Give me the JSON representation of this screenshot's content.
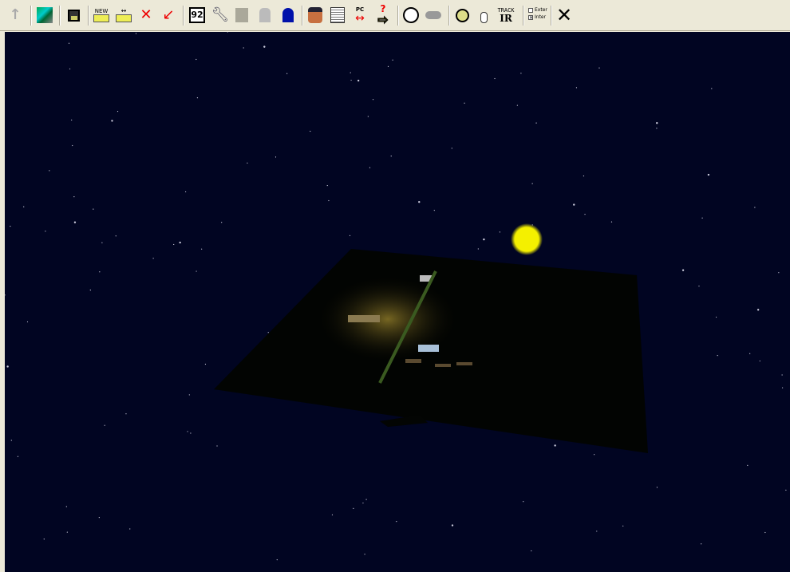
{
  "toolbar": {
    "new_label": "NEW",
    "track_label": "TRACK",
    "ir_label": "IR",
    "scenario_number": "92",
    "pc_label": "PC",
    "checkbox_exterior": {
      "label": "Exter",
      "checked": false
    },
    "checkbox_interior": {
      "label": "Inter",
      "checked": true
    },
    "icons": [
      "up-arrow-icon",
      "route-map-icon",
      "save-icon",
      "new-train-icon",
      "move-train-icon",
      "delete-train-icon",
      "pointer-icon",
      "scenario-icon",
      "wrench-icon",
      "disabled-chip-icon",
      "disabled-fuel-icon",
      "bell-icon",
      "driver-icon",
      "list-icon",
      "pc-driver-swap-icon",
      "help-arrow-icon",
      "clock-icon",
      "weather-icon",
      "steering-wheel-icon",
      "mouse-icon",
      "trackir-icon",
      "close-icon"
    ]
  },
  "colors": {
    "sky": "#010522",
    "sun": "#f4f000",
    "toolbar": "#ece9d8"
  }
}
